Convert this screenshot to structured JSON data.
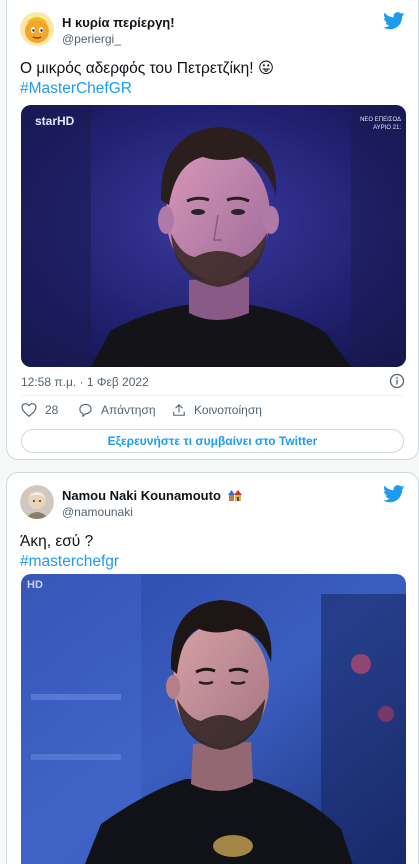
{
  "tweets": [
    {
      "author_name": "Η κυρία περίεργη!",
      "handle": "@periergi_",
      "text": "Ο μικρός αδερφός του Πετρετζίκη! 😛",
      "hashtag": "#MasterChefGR",
      "media_channel": "starHD",
      "media_overlay_line1": "ΝΕΟ ΕΠΕΙΣΟΔ",
      "media_overlay_line2": "ΑΥΡΙΟ 21:",
      "timestamp": "12:58 π.μ. · 1 Φεβ 2022",
      "likes": "28",
      "reply_label": "Απάντηση",
      "share_label": "Κοινοποίηση",
      "explore_label": "Εξερευνήστε τι συμβαίνει στο Twitter"
    },
    {
      "author_name": "Namou Naki Kounamouto",
      "handle": "@namounaki",
      "text": "Άκη, εσύ ?",
      "hashtag": "#masterchefgr",
      "media_channel": "HD"
    }
  ],
  "colors": {
    "twitter_blue": "#1d9bf0",
    "secondary_text": "#536471",
    "border": "#cfd9de"
  }
}
